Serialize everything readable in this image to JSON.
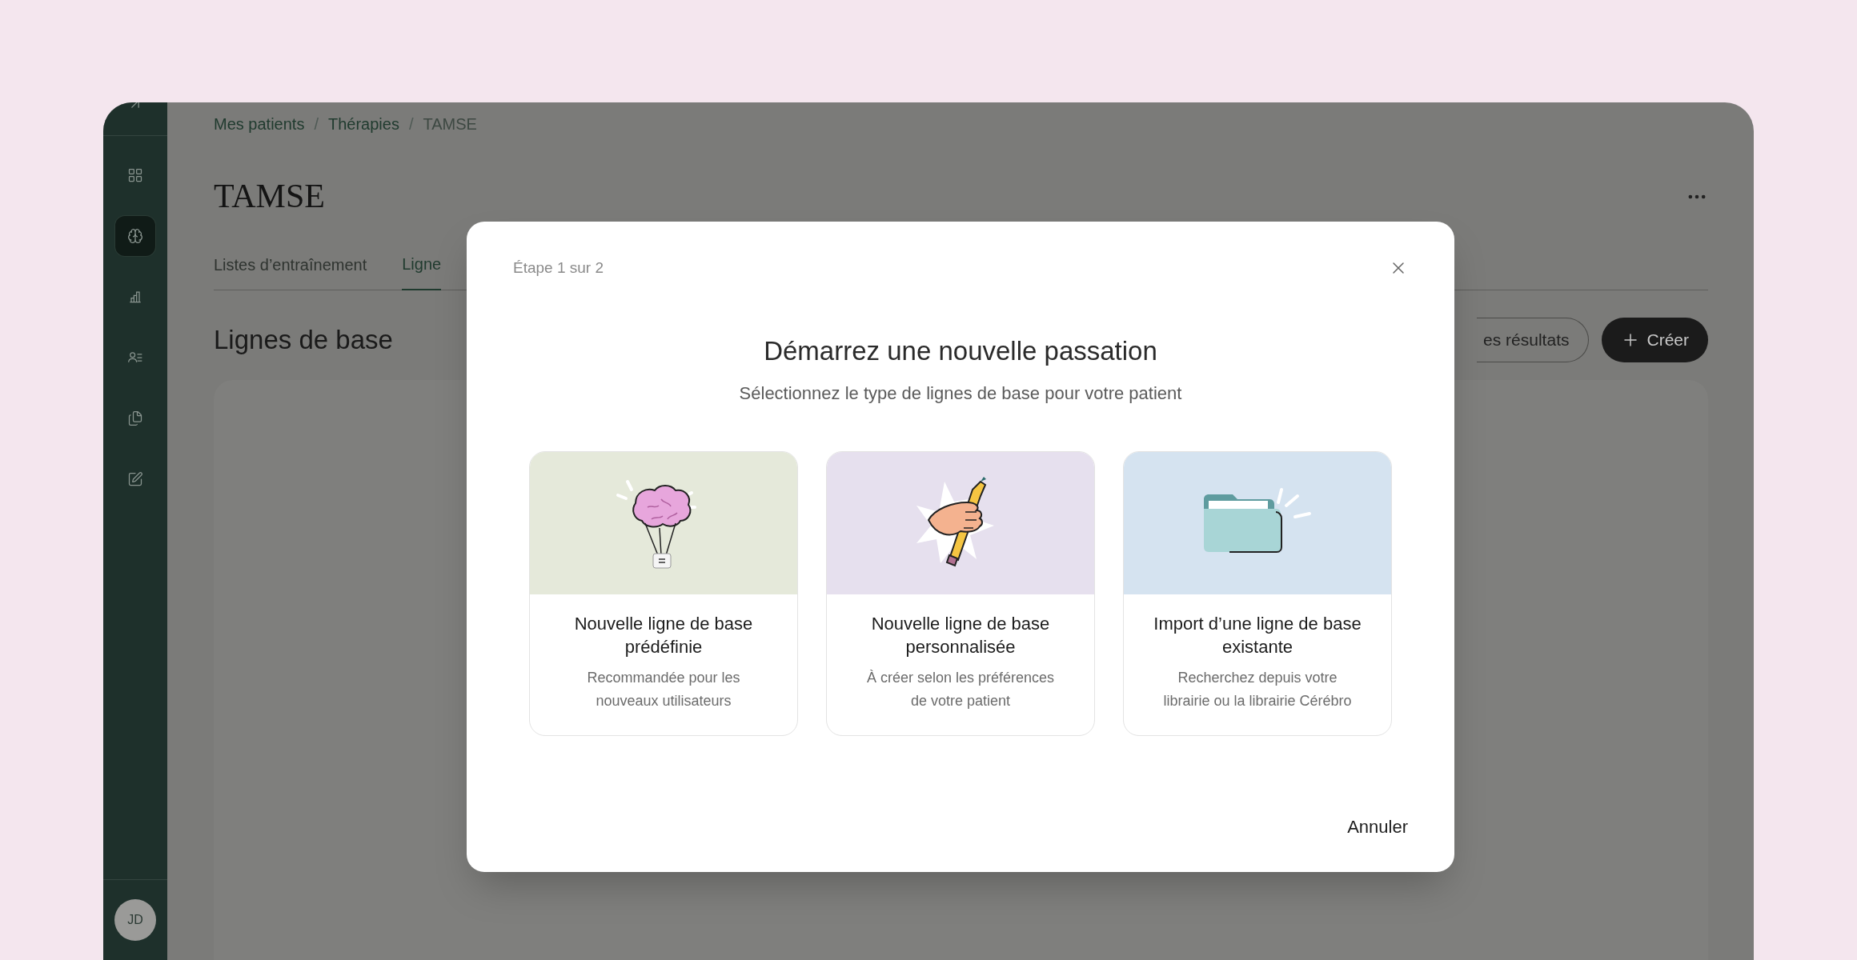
{
  "sidebar": {
    "items": [
      {
        "kind": "grid",
        "selected": false
      },
      {
        "kind": "brain",
        "selected": true
      },
      {
        "kind": "chart",
        "selected": false
      },
      {
        "kind": "users",
        "selected": false
      },
      {
        "kind": "files",
        "selected": false
      },
      {
        "kind": "edit",
        "selected": false
      }
    ],
    "avatar": "JD"
  },
  "breadcrumbs": [
    "Mes patients",
    "Thérapies",
    "TAMSE"
  ],
  "breadcrumb_separator": "/",
  "page_title": "TAMSE",
  "tabs": [
    {
      "label": "Listes d’entraînement",
      "selected": false
    },
    {
      "label": "Ligne",
      "selected": true
    }
  ],
  "section_title": "Lignes de base",
  "buttons": [
    {
      "kind": "outline",
      "label": "es résultats"
    },
    {
      "kind": "primary",
      "label": "Créer"
    }
  ],
  "modal": {
    "step": "Étape 1 sur 2",
    "title": "Démarrez une nouvelle passation",
    "subtitle": "Sélectionnez le type de lignes de base pour votre patient",
    "cards": [
      {
        "kind": "brain",
        "color": "#e5e9da",
        "title": "Nouvelle ligne de base prédéfinie",
        "description": "Recommandée pour les nouveaux utilisateurs"
      },
      {
        "kind": "pencil",
        "color": "#e6e0ee",
        "title": "Nouvelle ligne de base personnalisée",
        "description": "À créer selon les préférences de votre patient"
      },
      {
        "kind": "folder",
        "color": "#d5e3f0",
        "title": "Import d’une ligne de base existante",
        "description": "Recherchez depuis votre librairie ou la librairie Cérébro"
      }
    ],
    "cancel": "Annuler"
  }
}
